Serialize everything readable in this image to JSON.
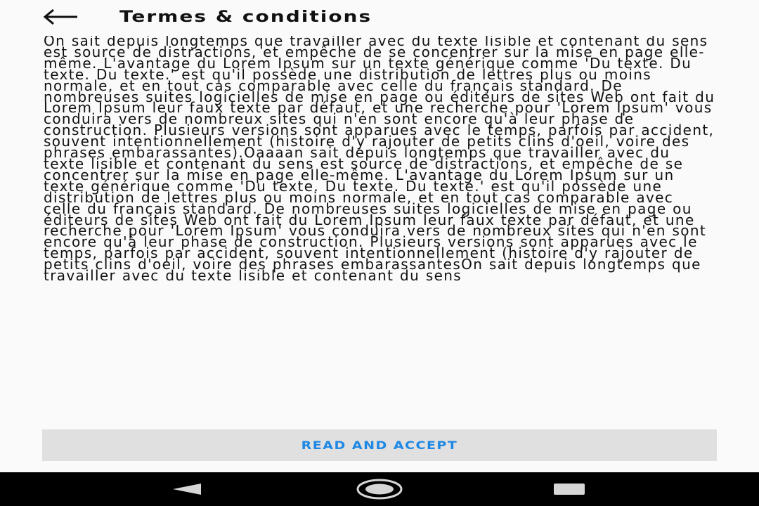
{
  "header": {
    "title": "Termes & conditions",
    "back_icon": "arrow-back-icon"
  },
  "terms": {
    "body": "On sait depuis longtemps que travailler avec du texte lisible et contenant du sens est source de distractions, et empêche de se concentrer sur la mise en page elle-même. L'avantage du Lorem Ipsum sur un texte générique comme 'Du texte. Du texte. Du texte.' est qu'il possède une distribution de lettres plus ou moins normale, et en tout cas comparable avec celle du français standard. De nombreuses suites logicielles de mise en page ou éditeurs de sites Web ont fait du Lorem Ipsum leur faux texte par défaut, et une recherche pour 'Lorem Ipsum' vous conduira vers de nombreux sites qui n'en sont encore qu'à leur phase de construction. Plusieurs versions sont apparues avec le temps, parfois par accident, souvent intentionnellement (histoire d'y rajouter de petits clins d'oeil, voire des phrases embarassantes).Oaaaan  sait depuis longtemps que travailler avec du texte lisible et contenant du sens est source de distractions, et empêche de se concentrer sur la mise en page elle-même. L'avantage du Lorem Ipsum sur un texte générique comme 'Du texte. Du texte. Du texte.' est qu'il possède une distribution de lettres plus ou moins normale, et en tout cas comparable avec celle du français standard. De nombreuses suites logicielles de mise en page ou éditeurs de sites Web ont fait du Lorem Ipsum leur faux texte par défaut, et une recherche pour 'Lorem Ipsum' vous conduira vers de nombreux sites qui n'en sont encore qu'à leur phase de construction. Plusieurs versions sont apparues avec le temps, parfois par accident, souvent intentionnellement (histoire d'y rajouter de petits clins d'oeil, voire des phrases embarassantesOn sait depuis longtemps que travailler avec du texte lisible et contenant du sens"
  },
  "actions": {
    "accept_label": "READ AND ACCEPT",
    "accent_color": "#1e88e5"
  },
  "system_nav": {
    "back_icon": "nav-back-triangle-icon",
    "home_icon": "nav-home-circle-icon",
    "recents_icon": "nav-recents-square-icon"
  }
}
